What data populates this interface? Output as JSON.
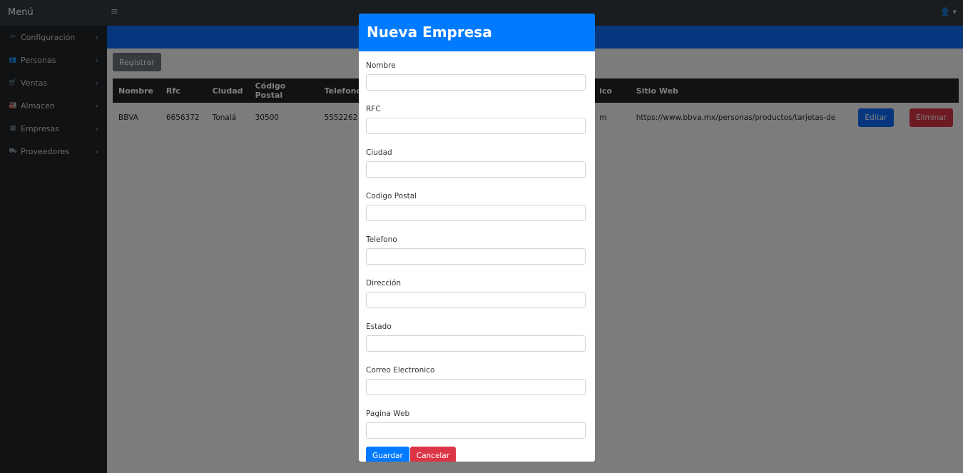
{
  "sidebar": {
    "title": "Menú",
    "items": [
      {
        "label": "Configuración",
        "icon": "tools-icon",
        "glyph": "✂"
      },
      {
        "label": "Personas",
        "icon": "users-icon",
        "glyph": "👥"
      },
      {
        "label": "Ventas",
        "icon": "cart-icon",
        "glyph": "🛒"
      },
      {
        "label": "Almacen",
        "icon": "warehouse-icon",
        "glyph": "🏭"
      },
      {
        "label": "Empresas",
        "icon": "building-icon",
        "glyph": "▦"
      },
      {
        "label": "Proveedores",
        "icon": "truck-icon",
        "glyph": "⛟"
      }
    ],
    "chevron": "›"
  },
  "topbar": {
    "hamburger": "≡",
    "user_glyph": "👤 ▾"
  },
  "content": {
    "register_label": "Registrar",
    "table": {
      "headers": [
        "Nombre",
        "Rfc",
        "Ciudad",
        "Código Postal",
        "Telefono",
        "",
        "",
        "ico",
        "Sitio Web",
        "",
        ""
      ],
      "rows": [
        {
          "nombre": "BBVA",
          "rfc": "6656372",
          "ciudad": "Tonalá",
          "cp": "30500",
          "telefono": "5552262",
          "correo_tail": "m",
          "sitio": "https://www.bbva.mx/personas/productos/tarjetas-de",
          "edit_label": "Editar",
          "delete_label": "Eliminar"
        }
      ]
    }
  },
  "modal": {
    "title": "Nueva Empresa",
    "fields": [
      {
        "label": "Nombre",
        "value": ""
      },
      {
        "label": "RFC",
        "value": ""
      },
      {
        "label": "Ciudad",
        "value": ""
      },
      {
        "label": "Codigo Postal",
        "value": ""
      },
      {
        "label": "Telefono",
        "value": ""
      },
      {
        "label": "Dirección",
        "value": ""
      },
      {
        "label": "Estado",
        "value": ""
      },
      {
        "label": "Correo Electronico",
        "value": ""
      },
      {
        "label": "Pagina Web",
        "value": ""
      }
    ],
    "save_label": "Guardar",
    "cancel_label": "Cancelar"
  },
  "colors": {
    "primary": "#007bff",
    "danger": "#dc3545",
    "sidebar": "#212529",
    "topbar": "#343a40",
    "secondary": "#6c757d"
  }
}
